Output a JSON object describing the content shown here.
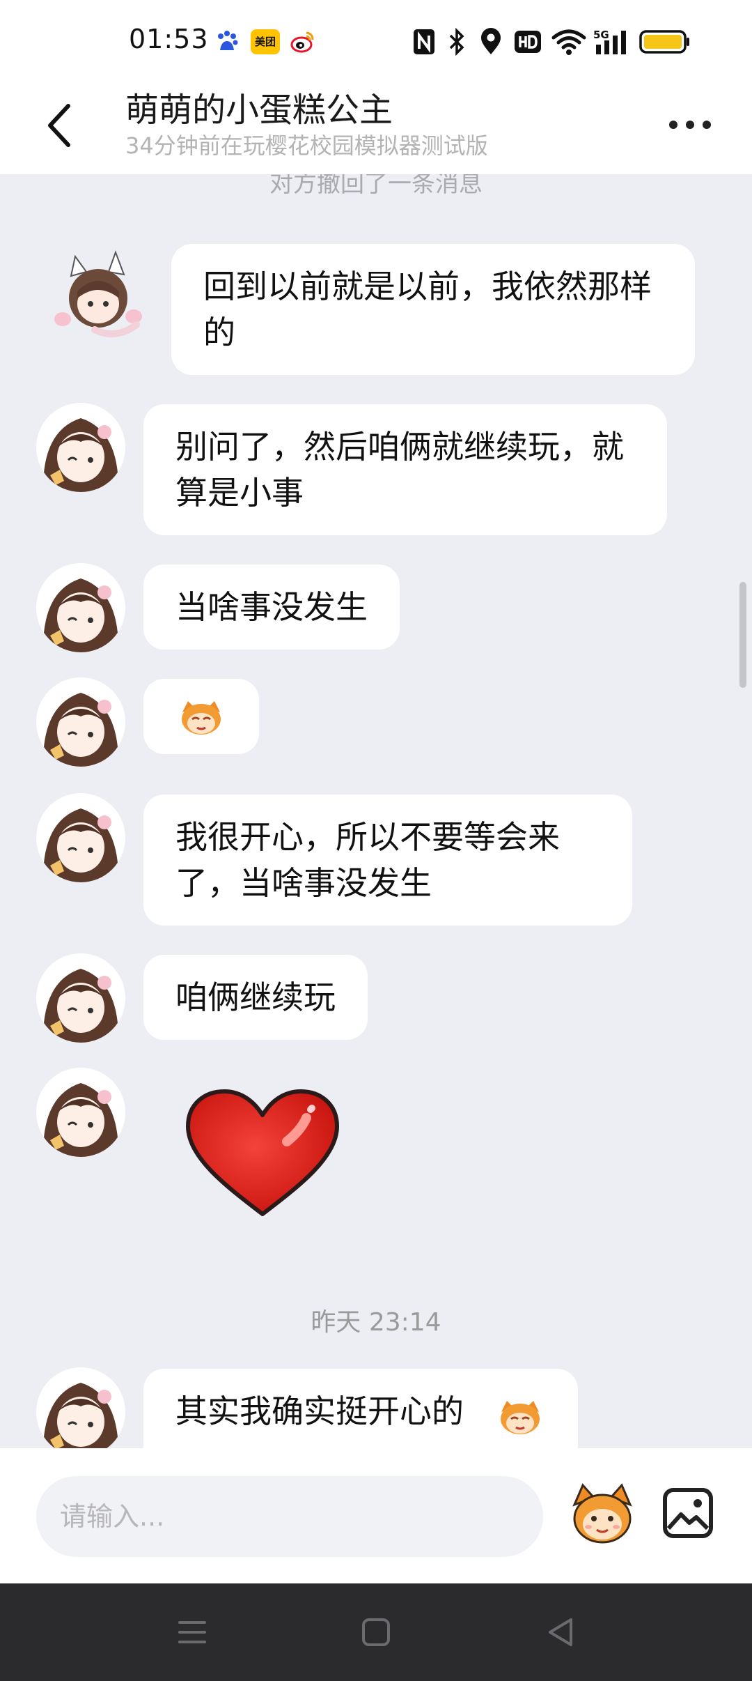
{
  "status_bar": {
    "time": "01:53",
    "icons": [
      "baidu-icon",
      "meituan-icon",
      "weibo-icon",
      "nfc-icon",
      "bluetooth-icon",
      "location-icon",
      "hd-icon",
      "wifi-icon",
      "signal-5g-icon",
      "battery-icon"
    ],
    "meituan_label": "美团"
  },
  "header": {
    "name": "萌萌的小蛋糕公主",
    "subtitle": "34分钟前在玩樱花校园模拟器测试版"
  },
  "chat": {
    "recalled_notice": "对方撤回了一条消息",
    "messages": [
      {
        "type": "text",
        "text": "回到以前就是以前，我依然那样的"
      },
      {
        "type": "text",
        "text": "别问了，然后咱俩就继续玩，就算是小事"
      },
      {
        "type": "text",
        "text": "当啥事没发生"
      },
      {
        "type": "sticker",
        "icon": "monkey-emoji-icon"
      },
      {
        "type": "text",
        "text": "我很开心，所以不要等会来了，当啥事没发生"
      },
      {
        "type": "text",
        "text": "咱俩继续玩"
      },
      {
        "type": "sticker",
        "icon": "red-heart-icon"
      }
    ],
    "timestamp": "昨天 23:14",
    "last_message": {
      "type": "text",
      "text": "其实我确实挺开心的",
      "emoji": "monkey-emoji-icon"
    }
  },
  "input": {
    "placeholder": "请输入..."
  },
  "colors": {
    "background": "#ECEEF3",
    "bubble": "#FFFFFF",
    "nav_bar": "#2B2B2D",
    "battery": "#F5C518"
  }
}
